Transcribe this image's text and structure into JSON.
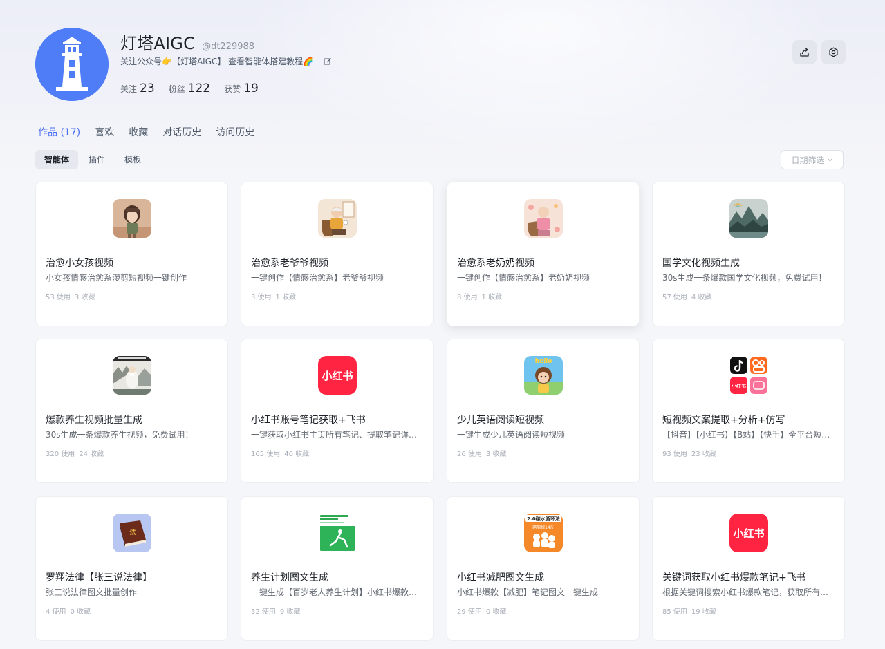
{
  "profile": {
    "name": "灯塔AIGC",
    "handle": "@dt229988",
    "bio": "关注公众号👉【灯塔AIGC】 查看智能体搭建教程🌈",
    "stats": [
      {
        "label": "关注",
        "value": "23"
      },
      {
        "label": "粉丝",
        "value": "122"
      },
      {
        "label": "获赞",
        "value": "19"
      }
    ]
  },
  "actions": {
    "share_icon": "share-icon",
    "settings_icon": "gear-icon"
  },
  "main_tabs": [
    "作品 (17)",
    "喜欢",
    "收藏",
    "对话历史",
    "访问历史"
  ],
  "sub_tabs": [
    "智能体",
    "插件",
    "模板"
  ],
  "date_filter": {
    "label": "日期筛选",
    "icon": "chevron-down-icon"
  },
  "cards": [
    {
      "title": "治愈小女孩视频",
      "desc": "小女孩情感治愈系漫剪短视频一键创作",
      "uses": "53 使用",
      "favs": "3 收藏",
      "icon": "girl-illustration-icon"
    },
    {
      "title": "治愈系老爷爷视频",
      "desc": "一键创作【情感治愈系】老爷爷视频",
      "uses": "3 使用",
      "favs": "1 收藏",
      "icon": "grandpa-illustration-icon"
    },
    {
      "title": "治愈系老奶奶视频",
      "desc": "一键创作【情感治愈系】老奶奶视频",
      "uses": "8 使用",
      "favs": "1 收藏",
      "icon": "grandma-illustration-icon"
    },
    {
      "title": "国学文化视频生成",
      "desc": "30s生成一条爆款国学文化视频，免费试用！",
      "uses": "57 使用",
      "favs": "4 收藏",
      "icon": "landscape-painting-icon"
    },
    {
      "title": "爆款养生视频批量生成",
      "desc": "30s生成一条爆款养生视频，免费试用！",
      "uses": "320 使用",
      "favs": "24 收藏",
      "icon": "ink-sage-painting-icon"
    },
    {
      "title": "小红书账号笔记获取+飞书",
      "desc": "一键获取小红书主页所有笔记、提取笔记详情并同步到飞书表格",
      "uses": "165 使用",
      "favs": "40 收藏",
      "icon": "xiaohongshu-logo-icon",
      "icon_text": "小红书"
    },
    {
      "title": "少儿英语阅读短视频",
      "desc": "一键生成少儿英语阅读短视频",
      "uses": "26 使用",
      "favs": "3 收藏",
      "icon": "kid-english-icon",
      "icon_text": "hello"
    },
    {
      "title": "短视频文案提取+分析+仿写",
      "desc": "【抖音】【小红书】【B站】【快手】全平台短视频文案提取",
      "uses": "93 使用",
      "favs": "23 收藏",
      "icon": "platform-logos-icon",
      "icon_text": "小红书"
    },
    {
      "title": "罗翔法律【张三说法律】",
      "desc": "张三说法律图文批量创作",
      "uses": "4 使用",
      "favs": "0 收藏",
      "icon": "law-book-icon",
      "icon_text": "法"
    },
    {
      "title": "养生计划图文生成",
      "desc": "一键生成【百岁老人养生计划】小红书爆款图文笔记",
      "uses": "32 使用",
      "favs": "9 收藏",
      "icon": "health-plan-icon"
    },
    {
      "title": "小红书减肥图文生成",
      "desc": "小红书爆款【减肥】笔记图文一键生成",
      "uses": "29 使用",
      "favs": "0 收藏",
      "icon": "diet-poster-icon",
      "icon_text": "2.0碳水循环法",
      "icon_subtext": "两周掉14斤"
    },
    {
      "title": "关键词获取小红书爆款笔记+飞书",
      "desc": "根据关键词搜索小红书爆款笔记，获取所有笔记详情并同步到飞书",
      "uses": "85 使用",
      "favs": "19 收藏",
      "icon": "xiaohongshu-logo-icon",
      "icon_text": "小红书"
    }
  ],
  "colors": {
    "accent": "#4a6ff5",
    "xiaohongshu_red": "#ff2442",
    "avatar_blue": "#4f7cf7"
  }
}
